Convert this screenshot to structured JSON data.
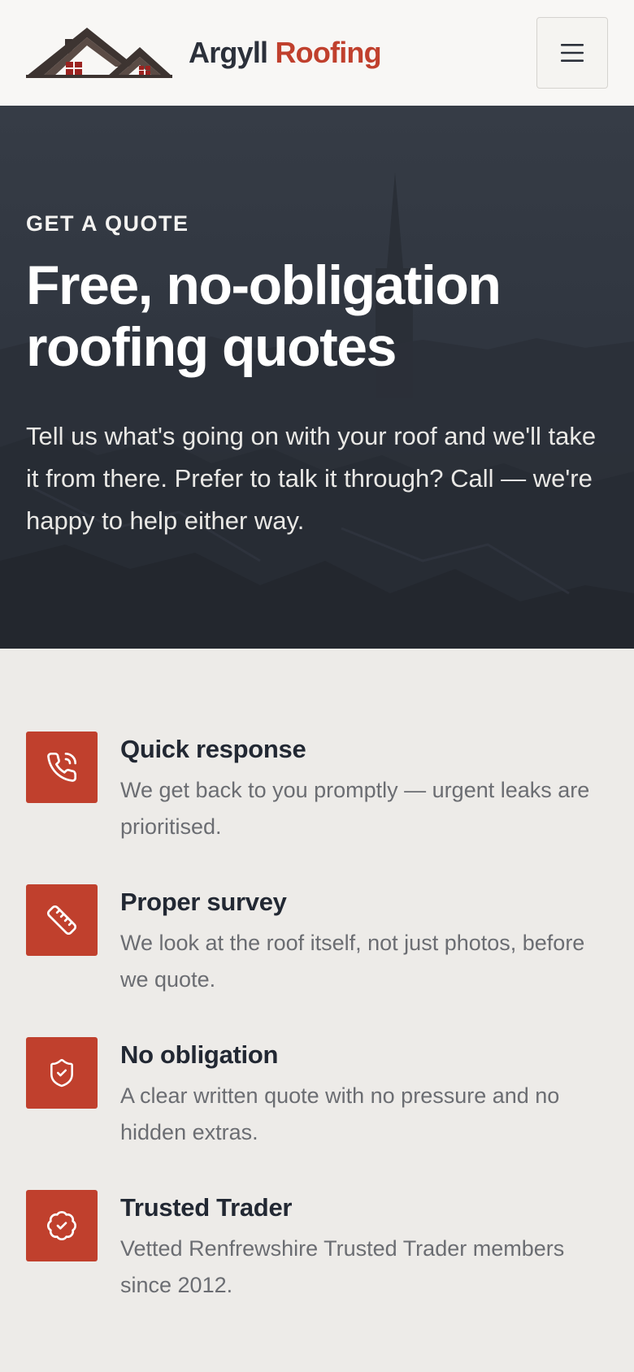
{
  "header": {
    "brand_primary": "Argyll",
    "brand_accent": "Roofing",
    "menu_icon": "hamburger-icon"
  },
  "hero": {
    "eyebrow": "GET A QUOTE",
    "title_line1": "Free, no-obligation",
    "title_line2": "roofing quotes",
    "lead": "Tell us what's going on with your roof and we'll take it from there. Prefer to talk it through? Call — we're happy to help either way."
  },
  "features": [
    {
      "icon": "phone-icon",
      "title": "Quick response",
      "text": "We get back to you promptly — urgent leaks are prioritised."
    },
    {
      "icon": "ruler-icon",
      "title": "Proper survey",
      "text": "We look at the roof itself, not just photos, before we quote."
    },
    {
      "icon": "shield-check-icon",
      "title": "No obligation",
      "text": "A clear written quote with no pressure and no hidden extras."
    },
    {
      "icon": "badge-check-icon",
      "title": "Trusted Trader",
      "text": "Vetted Renfrewshire Trusted Trader members since 2012."
    }
  ],
  "colors": {
    "accent": "#c0402d",
    "dark": "#2c323c",
    "page_bg": "#edebe8",
    "header_bg": "#f8f7f5"
  }
}
